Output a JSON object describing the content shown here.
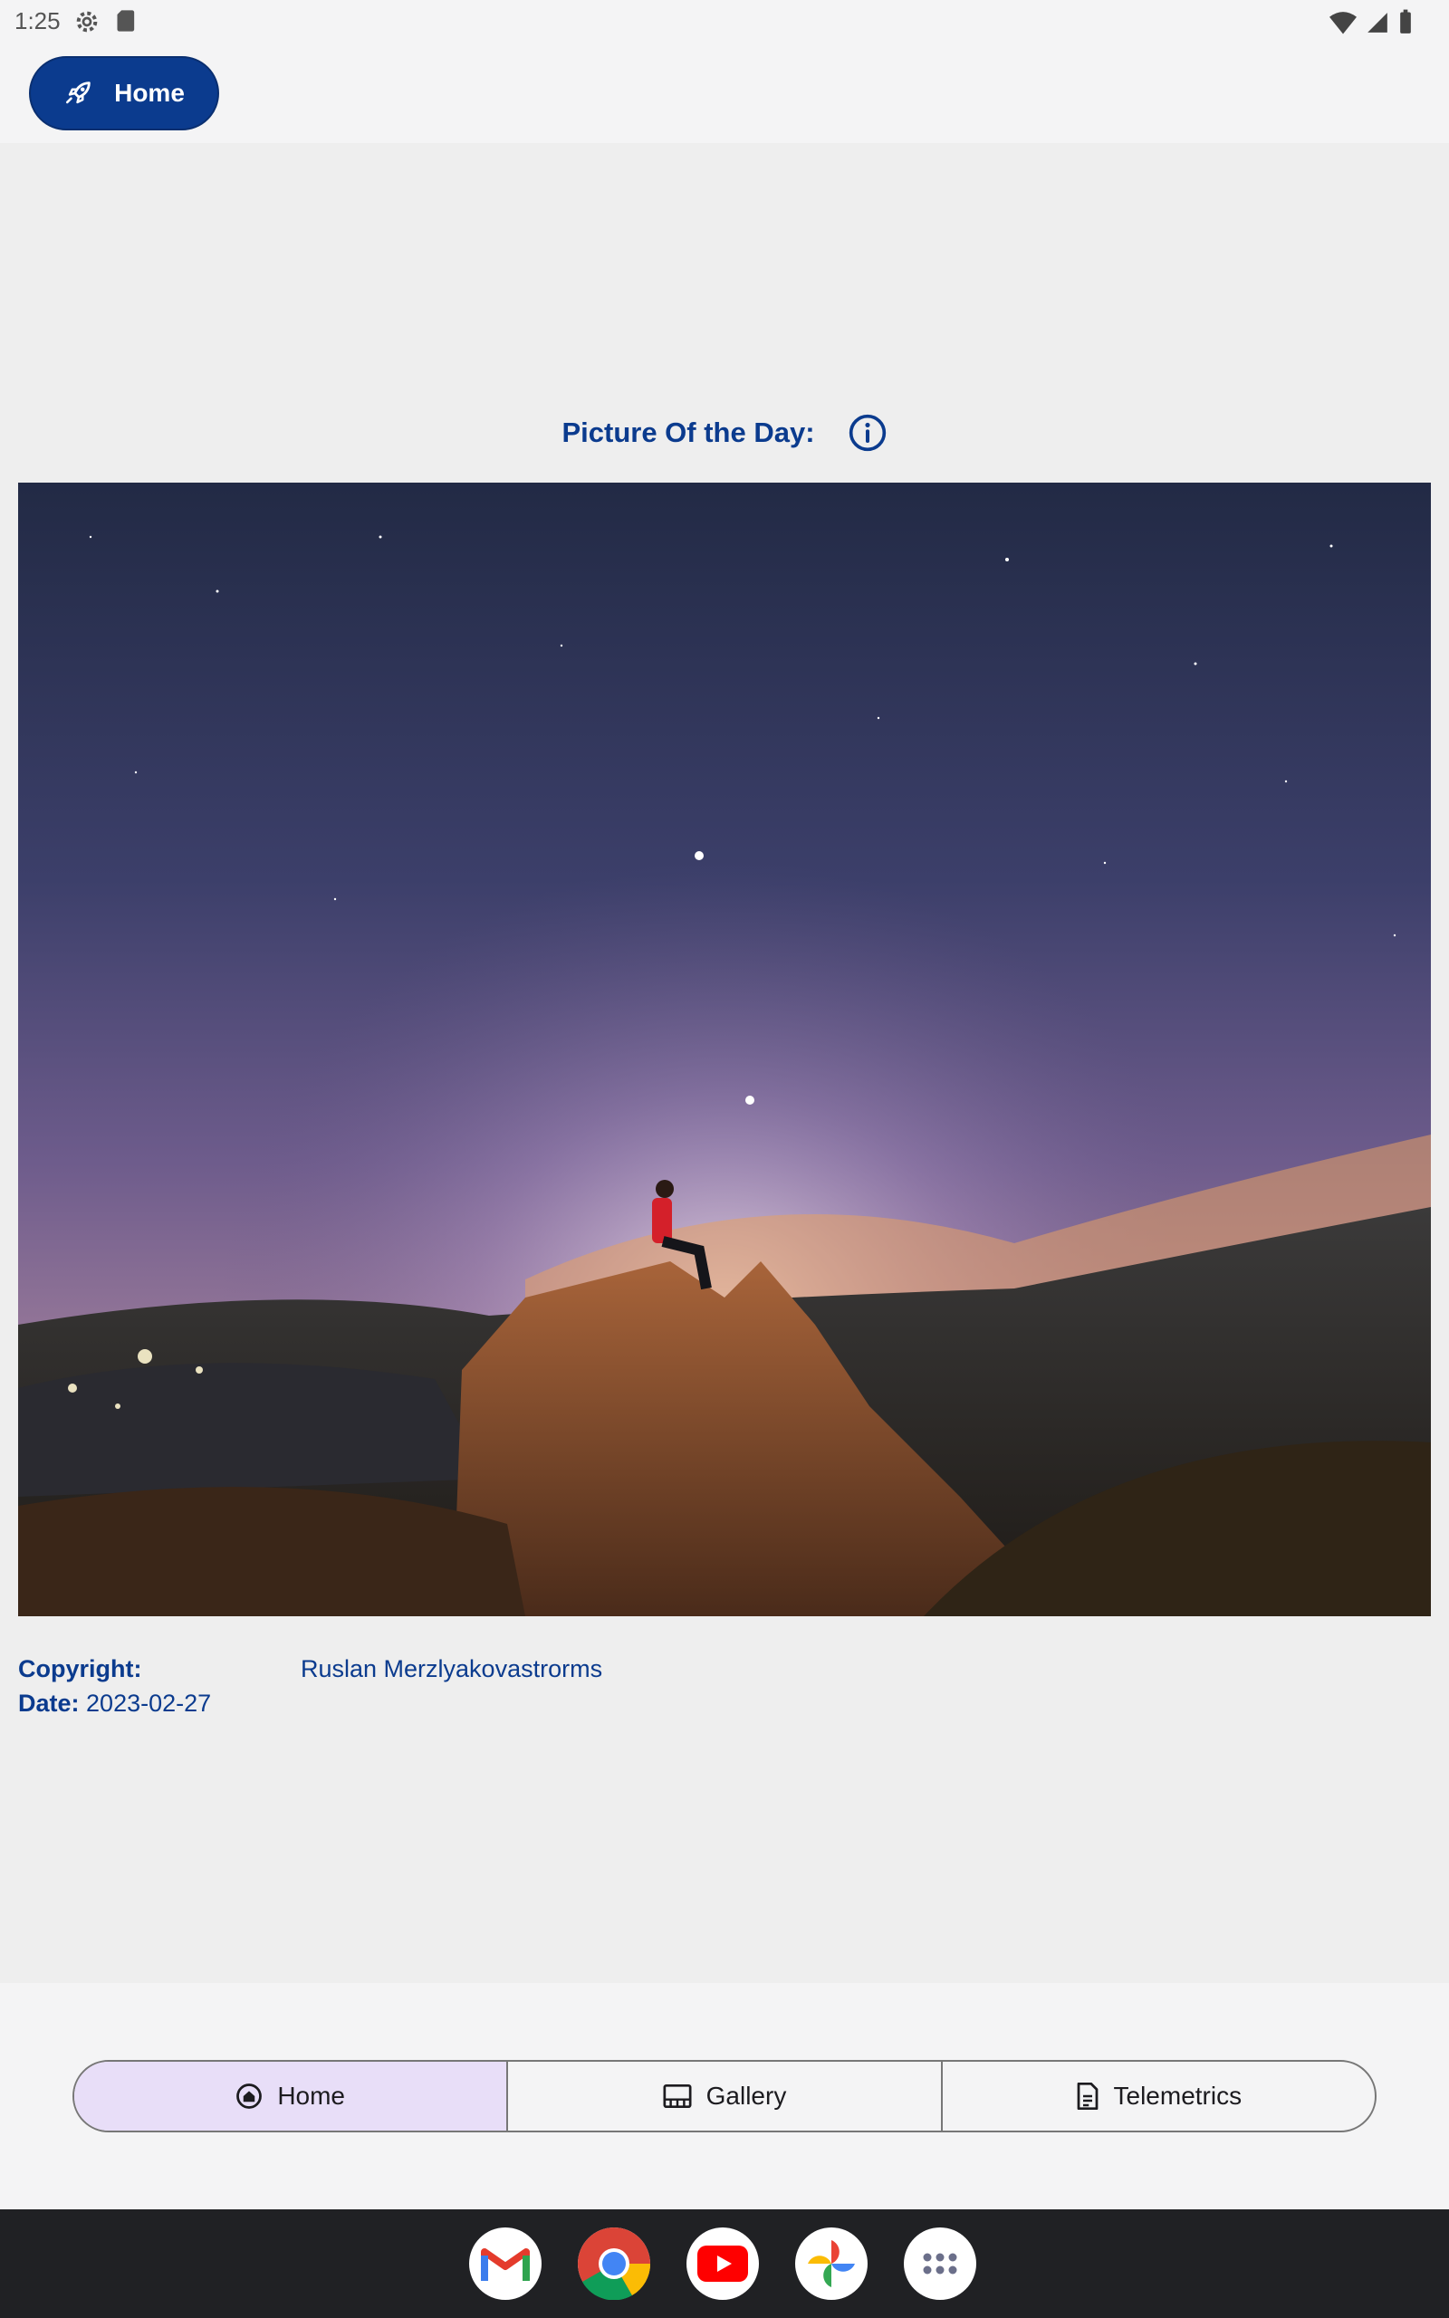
{
  "status_bar": {
    "time": "1:25"
  },
  "top_bar": {
    "home_label": "Home"
  },
  "potd": {
    "title": "Picture Of the Day:",
    "copyright_label": "Copyright:",
    "copyright_value": "Ruslan Merzlyakovastrorms",
    "date_label": "Date:",
    "date_value": "2023-02-27"
  },
  "bottom_nav": {
    "tabs": [
      {
        "label": "Home",
        "icon": "home-icon",
        "selected": true
      },
      {
        "label": "Gallery",
        "icon": "gallery-icon",
        "selected": false
      },
      {
        "label": "Telemetrics",
        "icon": "document-icon",
        "selected": false
      }
    ]
  },
  "dock": {
    "apps": [
      "gmail-icon",
      "chrome-icon",
      "youtube-icon",
      "photos-icon",
      "app-drawer-icon"
    ]
  },
  "colors": {
    "accent": "#0b3b8e",
    "selected_tab_bg": "#e8def8",
    "content_bg": "#eeeeee",
    "dock_bg": "#202124"
  }
}
